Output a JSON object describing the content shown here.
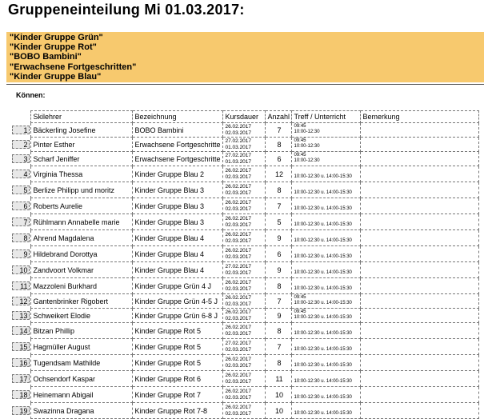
{
  "title": "Gruppeneinteilung Mi 01.03.2017:",
  "groups": [
    "\"Kinder Gruppe Grün\"",
    "\"Kinder Gruppe Rot\"",
    "\"BOBO Bambini\"",
    "\"Erwachsene Fortgeschritten\"",
    "\"Kinder Gruppe Blau\""
  ],
  "section_label": "Können:",
  "columns": [
    "Skilehrer",
    "Bezeichnung",
    "Kursdauer",
    "Anzahl",
    "Treff / Unterricht",
    "Bemerkung"
  ],
  "rows": [
    {
      "nr": "1",
      "name": "Bäckerling Josefine",
      "bez": "BOBO Bambini",
      "d1": "26.02.2017",
      "d2": "02.03.2017",
      "anzahl": "7",
      "treff_date": "09:45",
      "treff_time": "10:00-12:30"
    },
    {
      "nr": "2",
      "name": "Pinter Esther",
      "bez": "Erwachsene Fortgeschritte",
      "d1": "27.02.2017",
      "d2": "01.03.2017",
      "anzahl": "8",
      "treff_date": "09:45",
      "treff_time": "10:00-12:30"
    },
    {
      "nr": "3",
      "name": "Scharf Jeniffer",
      "bez": "Erwachsene Fortgeschritte",
      "d1": "27.02.2017",
      "d2": "01.03.2017",
      "anzahl": "6",
      "treff_date": "09:45",
      "treff_time": "10:00-12:30"
    },
    {
      "nr": "4",
      "name": "Virginia Thessa",
      "bez": "Kinder Gruppe Blau 2",
      "d1": "26.02.2017",
      "d2": "02.03.2017",
      "anzahl": "12",
      "treff_date": "",
      "treff_time": "10:00-12:30 u. 14:00-15:30"
    },
    {
      "nr": "5",
      "name": "Berlize Philipp und moritz",
      "bez": "Kinder Gruppe Blau 3",
      "d1": "26.02.2017",
      "d2": "02.03.2017",
      "anzahl": "8",
      "treff_date": "",
      "treff_time": "10:00-12:30 u. 14:00-15:30"
    },
    {
      "nr": "6",
      "name": "Roberts Aurelie",
      "bez": "Kinder Gruppe Blau 3",
      "d1": "26.02.2017",
      "d2": "02.03.2017",
      "anzahl": "7",
      "treff_date": "",
      "treff_time": "10:00-12:30 u. 14:00-15:30"
    },
    {
      "nr": "7",
      "name": "Rühlmann Annabelle marie",
      "bez": "Kinder Gruppe Blau 3",
      "d1": "26.02.2017",
      "d2": "02.03.2017",
      "anzahl": "5",
      "treff_date": "",
      "treff_time": "10:00-12:30 u. 14:00-15:30"
    },
    {
      "nr": "8",
      "name": "Ahrend Magdalena",
      "bez": "Kinder Gruppe Blau 4",
      "d1": "26.02.2017",
      "d2": "02.03.2017",
      "anzahl": "9",
      "treff_date": "",
      "treff_time": "10:00-12:30 u. 14:00-15:30"
    },
    {
      "nr": "9",
      "name": "Hildebrand Dorottya",
      "bez": "Kinder Gruppe Blau 4",
      "d1": "26.02.2017",
      "d2": "02.03.2017",
      "anzahl": "6",
      "treff_date": "",
      "treff_time": "10:00-12:30 u. 14:00-15:30"
    },
    {
      "nr": "10",
      "name": "Zandvoort Volkmar",
      "bez": "Kinder Gruppe Blau 4",
      "d1": "27.02.2017",
      "d2": "02.03.2017",
      "anzahl": "9",
      "treff_date": "",
      "treff_time": "10:00-12:30 u. 14:00-15:30"
    },
    {
      "nr": "11",
      "name": "Mazzoleni Burkhard",
      "bez": "Kinder Gruppe Grün 4 J",
      "d1": "26.02.2017",
      "d2": "02.03.2017",
      "anzahl": "8",
      "treff_date": "",
      "treff_time": "10:00-12:30 u. 14:00-15:30"
    },
    {
      "nr": "12",
      "name": "Gantenbrinker Rigobert",
      "bez": "Kinder Gruppe Grün 4-5 J",
      "d1": "26.02.2017",
      "d2": "02.03.2017",
      "anzahl": "7",
      "treff_date": "09:45",
      "treff_time": "10:00-12:30 u. 14:00-15:30"
    },
    {
      "nr": "13",
      "name": "Schweikert Elodie",
      "bez": "Kinder Gruppe Grün 6-8 J",
      "d1": "26.02.2017",
      "d2": "02.03.2017",
      "anzahl": "9",
      "treff_date": "09:45",
      "treff_time": "10:00-12:30 u. 14:00-15:30"
    },
    {
      "nr": "14",
      "name": "Bitzan Phillip",
      "bez": "Kinder Gruppe Rot 5",
      "d1": "26.02.2017",
      "d2": "02.03.2017",
      "anzahl": "8",
      "treff_date": "",
      "treff_time": "10:00-12:30 u. 14:00-15:30"
    },
    {
      "nr": "15",
      "name": "Hagmüller August",
      "bez": "Kinder Gruppe Rot 5",
      "d1": "27.02.2017",
      "d2": "02.03.2017",
      "anzahl": "7",
      "treff_date": "",
      "treff_time": "10:00-12:30 u. 14:00-15:30"
    },
    {
      "nr": "16",
      "name": "Tugendsam Mathilde",
      "bez": "Kinder Gruppe Rot 5",
      "d1": "26.02.2017",
      "d2": "02.03.2017",
      "anzahl": "8",
      "treff_date": "",
      "treff_time": "10:00-12:30 u. 14:00-15:30"
    },
    {
      "nr": "17",
      "name": "Ochsendorf Kaspar",
      "bez": "Kinder Gruppe Rot 6",
      "d1": "26.02.2017",
      "d2": "02.03.2017",
      "anzahl": "11",
      "treff_date": "",
      "treff_time": "10:00-12:30 u. 14:00-15:30"
    },
    {
      "nr": "18",
      "name": "Heinemann Abigail",
      "bez": "Kinder Gruppe Rot 7",
      "d1": "26.02.2017",
      "d2": "02.03.2017",
      "anzahl": "10",
      "treff_date": "",
      "treff_time": "10:00-12:30 u. 14:00-15:30"
    },
    {
      "nr": "19",
      "name": "Swazinna Dragana",
      "bez": "Kinder Gruppe Rot 7-8",
      "d1": "26.02.2017",
      "d2": "02.03.2017",
      "anzahl": "10",
      "treff_date": "",
      "treff_time": "10:00-12:30 u. 14:00-15:30"
    }
  ],
  "colors": {
    "group_box": "#f7c96e",
    "number_cell": "#e8e8e8"
  }
}
